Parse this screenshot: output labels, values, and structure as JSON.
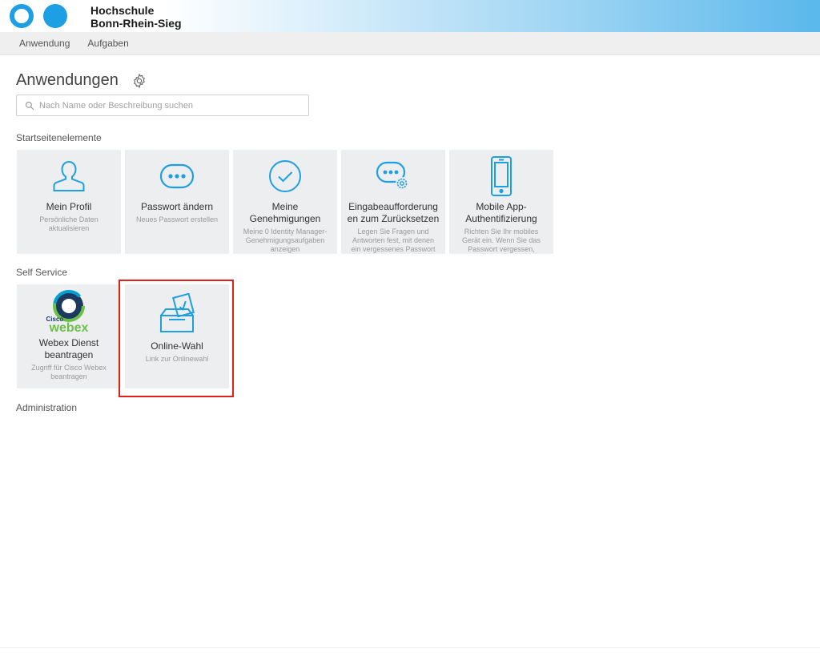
{
  "header": {
    "brand_line1": "Hochschule",
    "brand_line2": "Bonn-Rhein-Sieg",
    "brand_color": "#1e9fe3"
  },
  "menu": {
    "items": [
      {
        "label": "Anwendung"
      },
      {
        "label": "Aufgaben"
      }
    ]
  },
  "page": {
    "title": "Anwendungen",
    "search_placeholder": "Nach Name oder Beschreibung suchen"
  },
  "sections": {
    "start": {
      "label": "Startseitenelemente",
      "tiles": [
        {
          "title": "Mein Profil",
          "desc": "Persönliche Daten aktualisieren",
          "icon": "user-icon"
        },
        {
          "title": "Passwort ändern",
          "desc": "Neues Passwort erstellen",
          "icon": "password-dots-icon"
        },
        {
          "title": "Meine Genehmigungen",
          "desc": "Meine 0 Identity Manager-Genehmigungsaufgaben anzeigen",
          "icon": "checkmark-circle-icon"
        },
        {
          "title": "Eingabeaufforderung en zum Zurücksetzen",
          "desc": "Legen Sie Fragen und Antworten fest, mit denen ein vergessenes Passwort",
          "icon": "password-settings-icon"
        },
        {
          "title": "Mobile App-Authentifizierung",
          "desc": "Richten Sie Ihr mobiles Gerät ein. Wenn Sie das Passwort vergessen,",
          "icon": "mobile-phone-icon"
        }
      ]
    },
    "self_service": {
      "label": "Self Service",
      "tiles": [
        {
          "title": "Webex Dienst beantragen",
          "desc": "Zugriff für Cisco Webex beantragen",
          "icon": "webex-logo-icon",
          "logo_small": "Cisco",
          "logo_text": "webex"
        },
        {
          "title": "Online-Wahl",
          "desc": "Link zur Onlinewahl",
          "icon": "ballot-box-icon"
        }
      ]
    },
    "admin": {
      "label": "Administration"
    }
  },
  "colors": {
    "accent": "#1e9fe3",
    "tile_bg": "#eceeef",
    "highlight": "#e0201b"
  }
}
